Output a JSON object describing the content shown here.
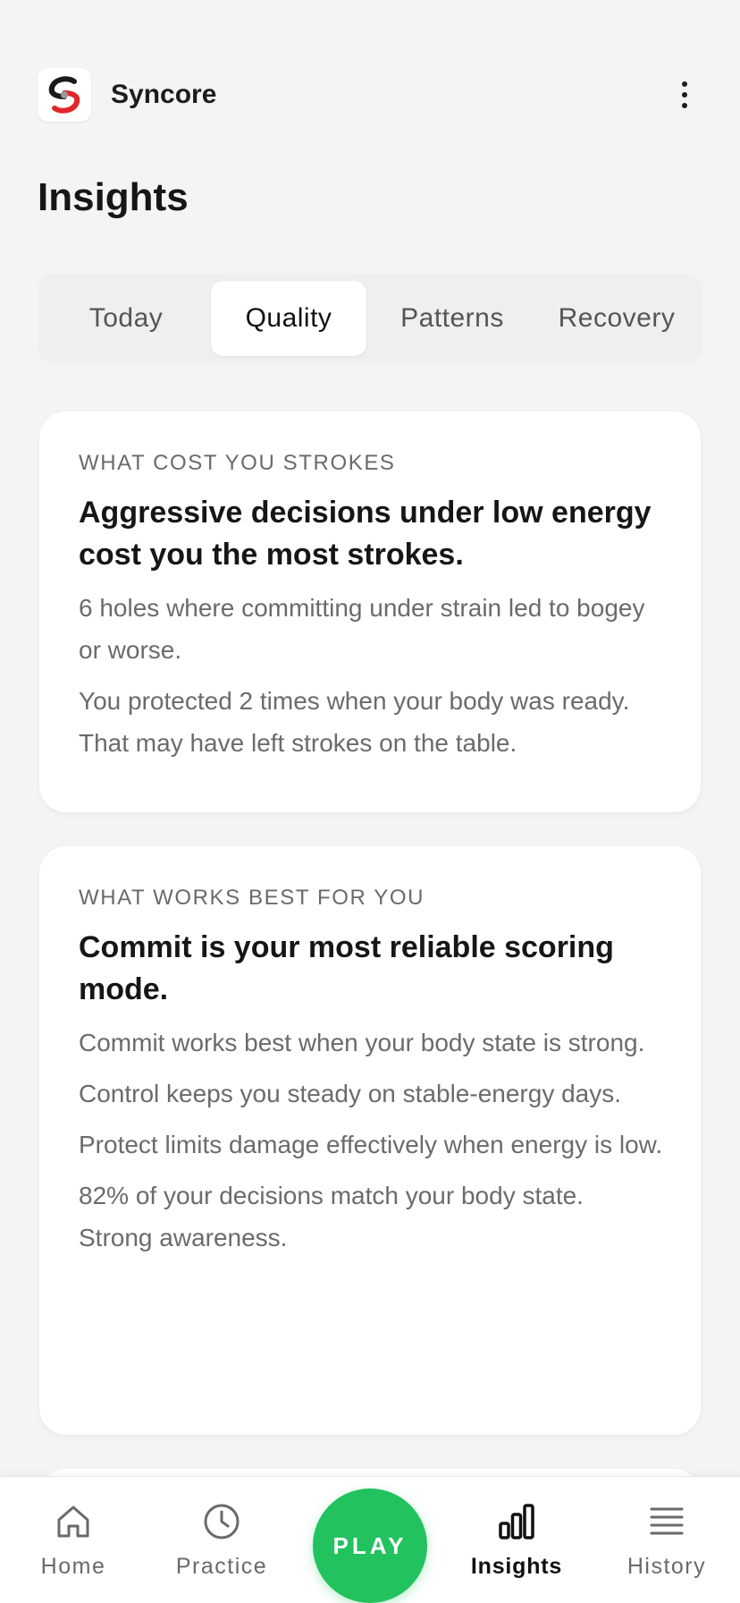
{
  "app": {
    "name": "Syncore"
  },
  "page": {
    "title": "Insights"
  },
  "tabs": [
    {
      "label": "Today",
      "active": false
    },
    {
      "label": "Quality",
      "active": true
    },
    {
      "label": "Patterns",
      "active": false
    },
    {
      "label": "Recovery",
      "active": false
    }
  ],
  "cards": [
    {
      "eyebrow": "WHAT COST YOU STROKES",
      "headline": "Aggressive decisions under low energy cost you the most strokes.",
      "lines": [
        "6 holes where committing under strain led to bogey or worse.",
        "You protected 2 times when your body was ready. That may have left strokes on the table."
      ]
    },
    {
      "eyebrow": "WHAT WORKS BEST FOR YOU",
      "headline": "Commit is your most reliable scoring mode.",
      "lines": [
        "Commit works best when your body state is strong.",
        "Control keeps you steady on stable-energy days.",
        "Protect limits damage effectively when energy is low.",
        "82% of your decisions match your body state. Strong awareness."
      ]
    }
  ],
  "nav": {
    "home": "Home",
    "practice": "Practice",
    "play": "PLAY",
    "insights": "Insights",
    "history": "History",
    "active": "insights"
  },
  "colors": {
    "accent": "#22c25e",
    "background": "#f4f4f3",
    "logo_red": "#e0262b"
  },
  "icons": {
    "more": "vertical-dots-icon",
    "home": "home-icon",
    "practice": "clock-icon",
    "insights": "bar-chart-icon",
    "history": "list-icon"
  }
}
